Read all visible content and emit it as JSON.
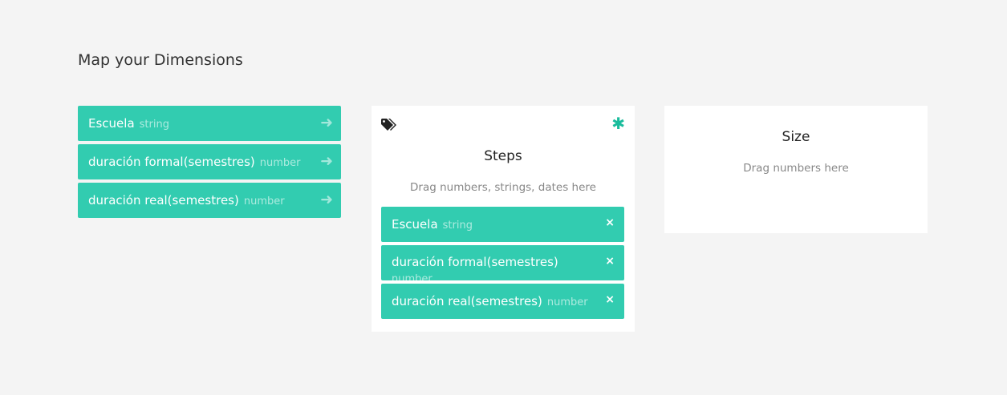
{
  "title": "Map your Dimensions",
  "dimensions": [
    {
      "name": "Escuela",
      "type": "string"
    },
    {
      "name": "duración formal(semestres)",
      "type": "number"
    },
    {
      "name": "duración real(semestres)",
      "type": "number"
    }
  ],
  "steps": {
    "title": "Steps",
    "hint": "Drag numbers, strings, dates here",
    "icon": "tags-icon",
    "required_icon": "asterisk-icon",
    "required_color": "#1abc9c",
    "items": [
      {
        "name": "Escuela",
        "type": "string",
        "remove": "×"
      },
      {
        "name": "duración formal(semestres)",
        "type": "number",
        "remove": "×"
      },
      {
        "name": "duración real(semestres)",
        "type": "number",
        "remove": "×"
      }
    ]
  },
  "size": {
    "title": "Size",
    "hint": "Drag numbers here"
  },
  "colors": {
    "accent": "#32ccb0",
    "background": "#f4f4f4"
  }
}
